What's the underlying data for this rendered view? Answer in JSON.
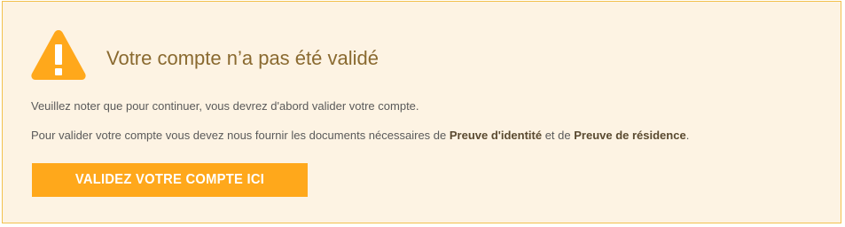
{
  "alert": {
    "icon": "warning-triangle-icon",
    "title": "Votre compte n’a pas été validé",
    "line1": "Veuillez noter que pour continuer, vous devrez d'abord valider votre compte.",
    "line2_prefix": "Pour valider votre compte vous devez nous fournir les documents nécessaires de ",
    "line2_bold1": "Preuve d'identité",
    "line2_middle": " et de ",
    "line2_bold2": "Preuve de résidence",
    "line2_suffix": ".",
    "button_label": "VALIDEZ VOTRE COMPTE ICI"
  },
  "colors": {
    "background": "#fdf3e3",
    "border": "#f2c14e",
    "accent": "#ffa81b",
    "title": "#8a6a30"
  }
}
